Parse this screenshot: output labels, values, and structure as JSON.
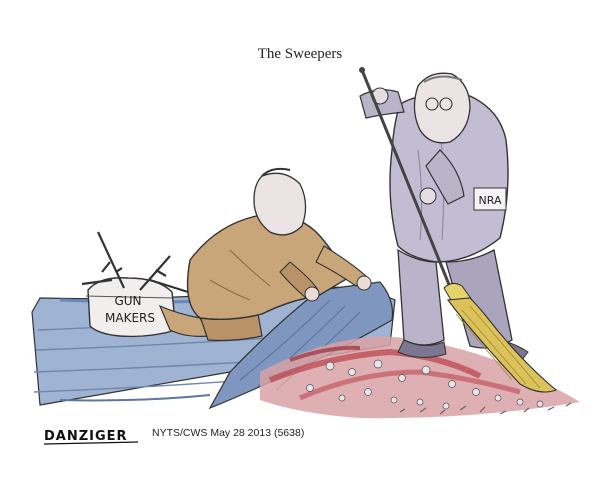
{
  "title": "The Sweepers",
  "labels": {
    "box": [
      "GUN",
      "MAKERS"
    ],
    "badge": "NRA"
  },
  "signature": "DANZIGER",
  "credit": "NYTS/CWS May 28 2013 (5638)",
  "colors": {
    "suit_tan": "#c9a57a",
    "suit_gray": "#b9b4c9",
    "carpet_blue": "#8fa6c6",
    "blood_red": "#b8404a"
  }
}
